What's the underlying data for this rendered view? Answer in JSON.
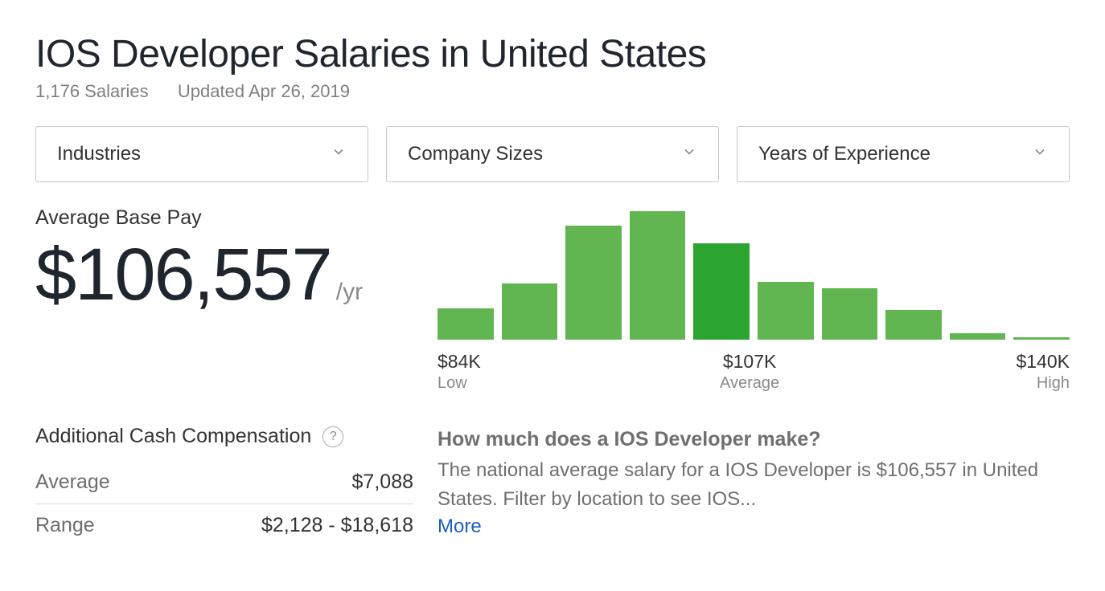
{
  "header": {
    "title": "IOS Developer Salaries in United States",
    "salary_count": "1,176 Salaries",
    "updated": "Updated Apr 26, 2019"
  },
  "filters": {
    "industries": "Industries",
    "company_sizes": "Company Sizes",
    "experience": "Years of Experience"
  },
  "average_base_pay": {
    "label": "Average Base Pay",
    "value": "$106,557",
    "unit": "/yr"
  },
  "chart_data": {
    "type": "bar",
    "categories": [
      "84K",
      "",
      "",
      "",
      "107K",
      "",
      "",
      "",
      "",
      "140K"
    ],
    "values": [
      38,
      68,
      138,
      155,
      116,
      70,
      62,
      36,
      8,
      3
    ],
    "highlight_index": 4,
    "xlabel": "",
    "ylabel": "",
    "axis_low": {
      "value": "$84K",
      "label": "Low"
    },
    "axis_mid": {
      "value": "$107K",
      "label": "Average"
    },
    "axis_high": {
      "value": "$140K",
      "label": "High"
    }
  },
  "additional_comp": {
    "heading": "Additional Cash Compensation",
    "average_label": "Average",
    "average_value": "$7,088",
    "range_label": "Range",
    "range_value": "$2,128 - $18,618"
  },
  "description": {
    "title": "How much does a IOS Developer make?",
    "body": "The national average salary for a IOS Developer is $106,557 in United States. Filter by location to see IOS...",
    "more": "More"
  }
}
